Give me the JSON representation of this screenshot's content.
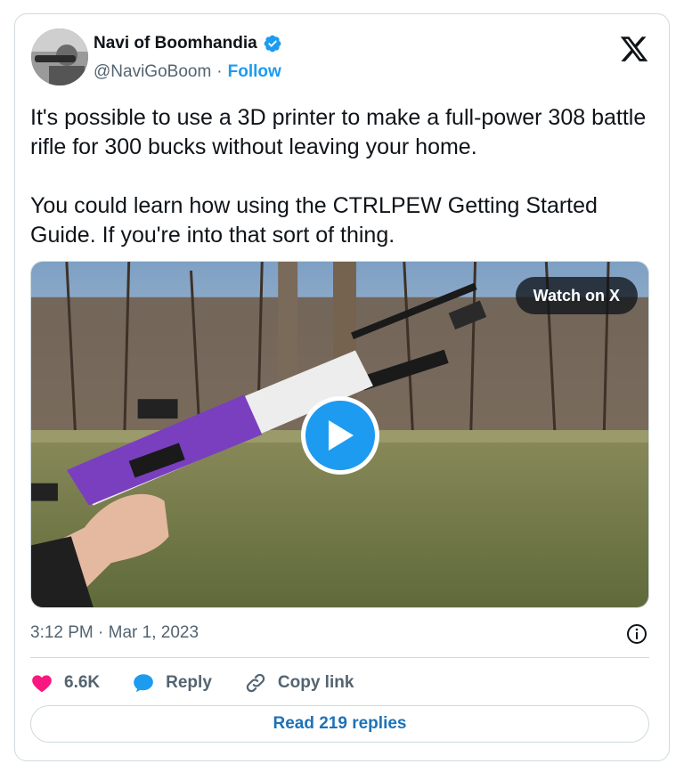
{
  "author": {
    "display_name": "Navi of Boomhandia",
    "handle": "@NaviGoBoom",
    "separator": "·",
    "follow_label": "Follow",
    "verified": true,
    "verified_color": "#1d9bf0"
  },
  "tweet": {
    "text": "It's possible to use a 3D printer to make a full-power 308 battle rifle for 300 bucks without leaving your home.\n\nYou could learn how using the CTRLPEW Getting Started Guide. If you're into that sort of thing.",
    "timestamp": "3:12 PM · Mar 1, 2023"
  },
  "media": {
    "watch_label": "Watch on X",
    "play_icon": "play-icon"
  },
  "actions": {
    "likes": "6.6K",
    "reply_label": "Reply",
    "copy_link_label": "Copy link"
  },
  "replies_button": "Read 219 replies",
  "colors": {
    "accent": "#1d9bf0",
    "like": "#f91880",
    "muted": "#536471",
    "border": "#cfd9de"
  }
}
